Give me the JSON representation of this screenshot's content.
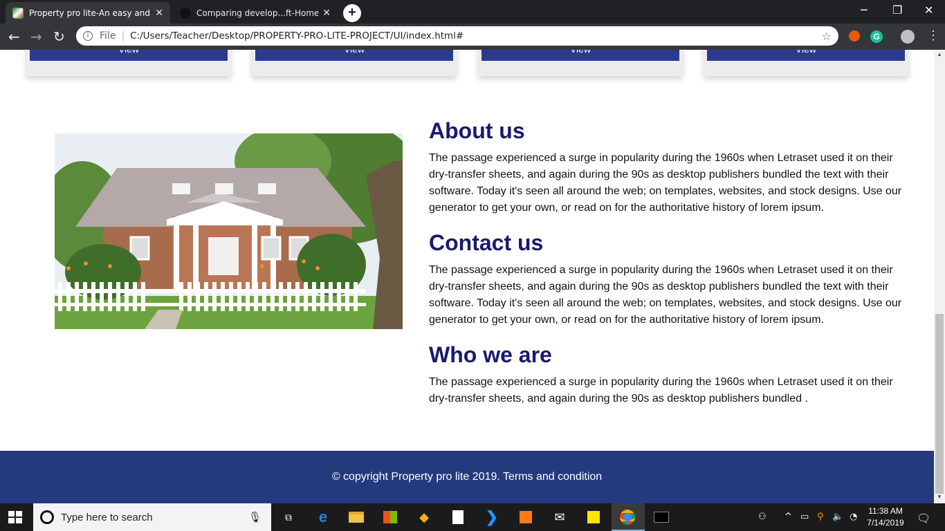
{
  "browser": {
    "tabs": [
      {
        "title": "Property pro lite-An easy and reli",
        "active": true
      },
      {
        "title": "Comparing develop...ft-Home-Pa",
        "active": false
      }
    ],
    "close_glyph": "✕",
    "new_tab_glyph": "+",
    "address": {
      "scheme": "File",
      "url": "C:/Users/Teacher/Desktop/PROPERTY-PRO-LITE-PROJECT/UI/index.html#"
    },
    "extensions": [
      "fire-extension-icon",
      "grammarly-icon"
    ],
    "grammarly_letter": "G"
  },
  "cards": {
    "button_label": "View",
    "count": 4
  },
  "sections": [
    {
      "heading": "About us",
      "body": "The passage experienced a surge in popularity during the 1960s when Letraset used it on their dry-transfer sheets, and again during the 90s as desktop publishers bundled the text with their software. Today it's seen all around the web; on templates, websites, and stock designs. Use our generator to get your own, or read on for the authoritative history of lorem ipsum."
    },
    {
      "heading": "Contact us",
      "body": "The passage experienced a surge in popularity during the 1960s when Letraset used it on their dry-transfer sheets, and again during the 90s as desktop publishers bundled the text with their software. Today it's seen all around the web; on templates, websites, and stock designs. Use our generator to get your own, or read on for the authoritative history of lorem ipsum."
    },
    {
      "heading": "Who we are",
      "body": "The passage experienced a surge in popularity during the 1960s when Letraset used it on their dry-transfer sheets, and again during the 90s as desktop publishers bundled ."
    }
  ],
  "footer": {
    "text": "© copyright Property pro lite 2019. Terms and condition"
  },
  "taskbar": {
    "search_placeholder": "Type here to search",
    "clock_time": "11:38 AM",
    "clock_date": "7/14/2019"
  },
  "colors": {
    "heading": "#1a1a6e",
    "footer_bg": "#233b7d",
    "button_bg": "#2b3a8f"
  }
}
